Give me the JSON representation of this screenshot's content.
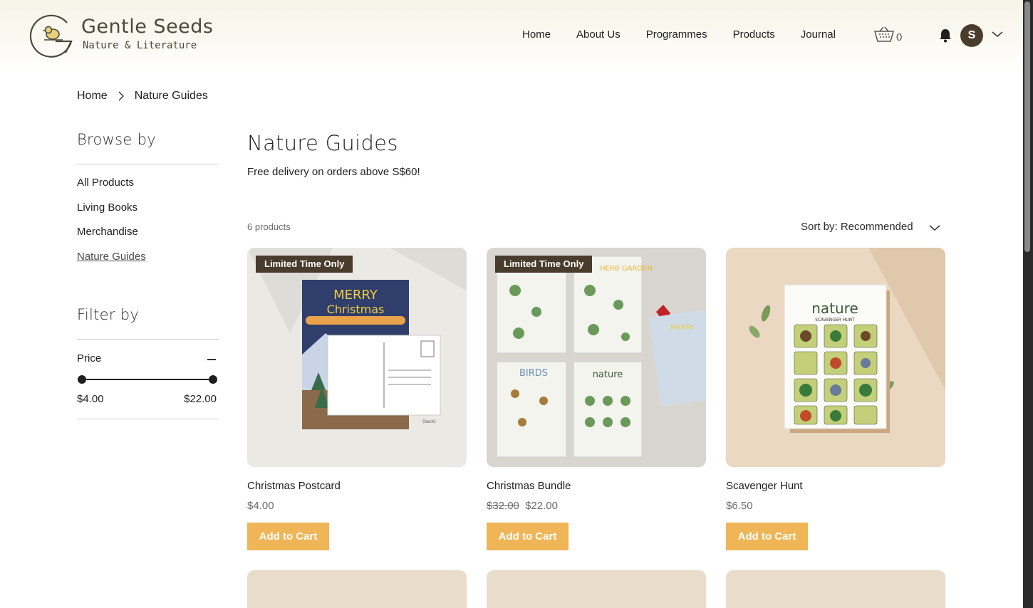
{
  "brand": {
    "name": "Gentle Seeds",
    "tagline": "Nature & Literature"
  },
  "nav": {
    "items": [
      "Home",
      "About Us",
      "Programmes",
      "Products",
      "Journal"
    ]
  },
  "cart": {
    "count": "0"
  },
  "user": {
    "initial": "S"
  },
  "breadcrumb": {
    "home": "Home",
    "current": "Nature Guides"
  },
  "sidebar": {
    "browse_heading": "Browse by",
    "links": [
      "All Products",
      "Living Books",
      "Merchandise",
      "Nature Guides"
    ],
    "active_index": 3,
    "filter_heading": "Filter by",
    "price_label": "Price",
    "price_min": "$4.00",
    "price_max": "$22.00"
  },
  "main": {
    "title": "Nature Guides",
    "promo": "Free delivery on orders above S$60!",
    "count": "6 products",
    "sort_label": "Sort by: Recommended"
  },
  "products": [
    {
      "name": "Christmas Postcard",
      "price": "$4.00",
      "old_price": "",
      "badge": "Limited Time Only",
      "button": "Add to Cart"
    },
    {
      "name": "Christmas Bundle",
      "price": "$22.00",
      "old_price": "$32.00",
      "badge": "Limited Time Only",
      "button": "Add to Cart"
    },
    {
      "name": "Scavenger Hunt",
      "price": "$6.50",
      "old_price": "",
      "badge": "",
      "button": "Add to Cart"
    }
  ],
  "colors": {
    "accent": "#efb556",
    "badge": "#4a3c2c",
    "avatar": "#4a3c2c"
  }
}
